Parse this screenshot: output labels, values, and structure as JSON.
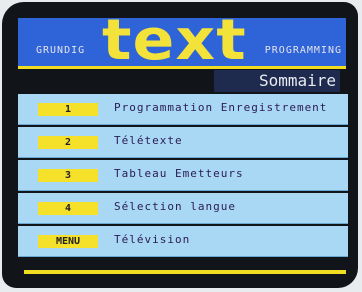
{
  "header": {
    "brand": "GRUNDIG",
    "logo": "text",
    "mode": "PROGRAMMING"
  },
  "page_title": "Sommaire",
  "menu": {
    "items": [
      {
        "key": "1",
        "label": "Programmation Enregistrement"
      },
      {
        "key": "2",
        "label": "Télétexte"
      },
      {
        "key": "3",
        "label": "Tableau Emetteurs"
      },
      {
        "key": "4",
        "label": "Sélection langue"
      },
      {
        "key": "MENU",
        "label": "Télévision"
      }
    ]
  },
  "colors": {
    "header_bg": "#2f63d8",
    "logo": "#f3e23a",
    "row_bg": "#a8d8f4",
    "key_bg": "#f5e02a",
    "screen_bg": "#111519"
  }
}
